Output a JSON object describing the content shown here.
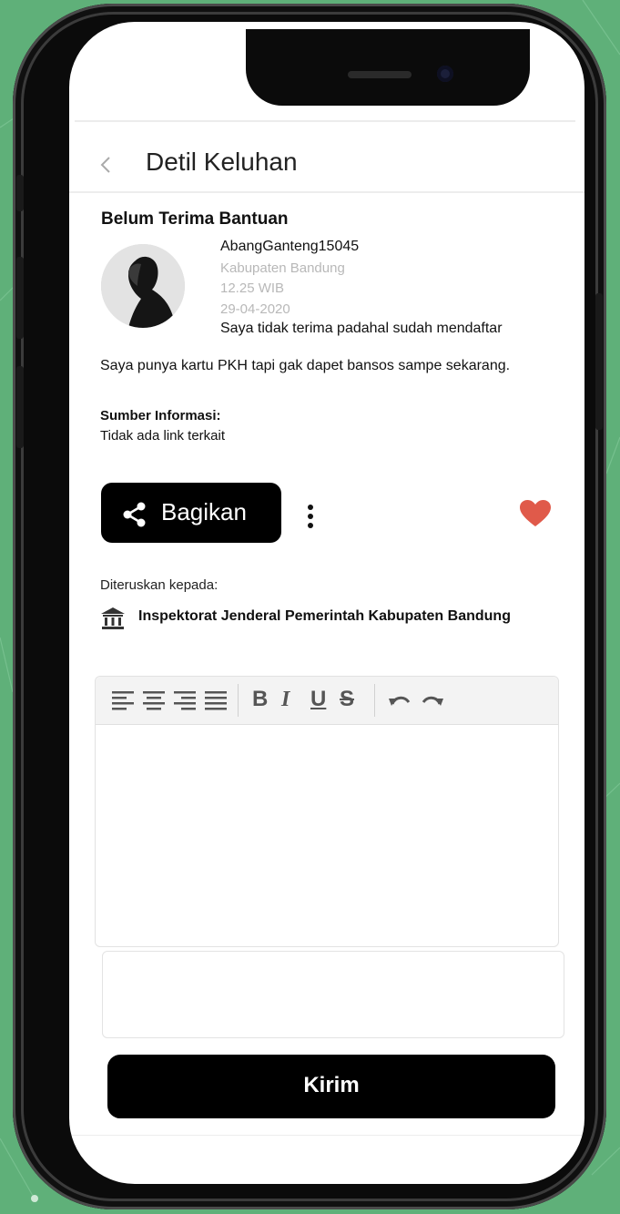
{
  "header": {
    "title": "Detil Keluhan",
    "back_icon": "chevron-left-icon"
  },
  "complaint": {
    "title": "Belum Terima Bantuan",
    "username": "AbangGanteng15045",
    "location": "Kabupaten Bandung",
    "time": "12.25 WIB",
    "date": "29-04-2020",
    "summary": "Saya tidak terima padahal sudah mendaftar",
    "description": "Saya punya kartu PKH tapi gak dapet bansos sampe sekarang.",
    "source_label": "Sumber Informasi:",
    "source_value": "Tidak ada link terkait"
  },
  "actions": {
    "share_label": "Bagikan",
    "share_icon": "share-icon",
    "more_icon": "more-vertical-icon",
    "favorite_icon": "heart-icon",
    "favorite_color": "#e05a4a"
  },
  "forwarded": {
    "label": "Diteruskan kepada:",
    "icon": "institution-icon",
    "institution": "Inspektorat Jenderal Pemerintah Kabupaten Bandung"
  },
  "editor": {
    "toolbar": [
      "align-left-icon",
      "align-center-icon",
      "align-right-icon",
      "align-justify-icon",
      "bold-icon",
      "italic-icon",
      "underline-icon",
      "strikethrough-icon",
      "undo-icon",
      "redo-icon"
    ],
    "bold_glyph": "B",
    "italic_glyph": "I",
    "underline_glyph": "U",
    "strike_glyph": "S"
  },
  "submit": {
    "label": "Kirim"
  },
  "colors": {
    "background": "#5fb079",
    "button": "#000000"
  }
}
